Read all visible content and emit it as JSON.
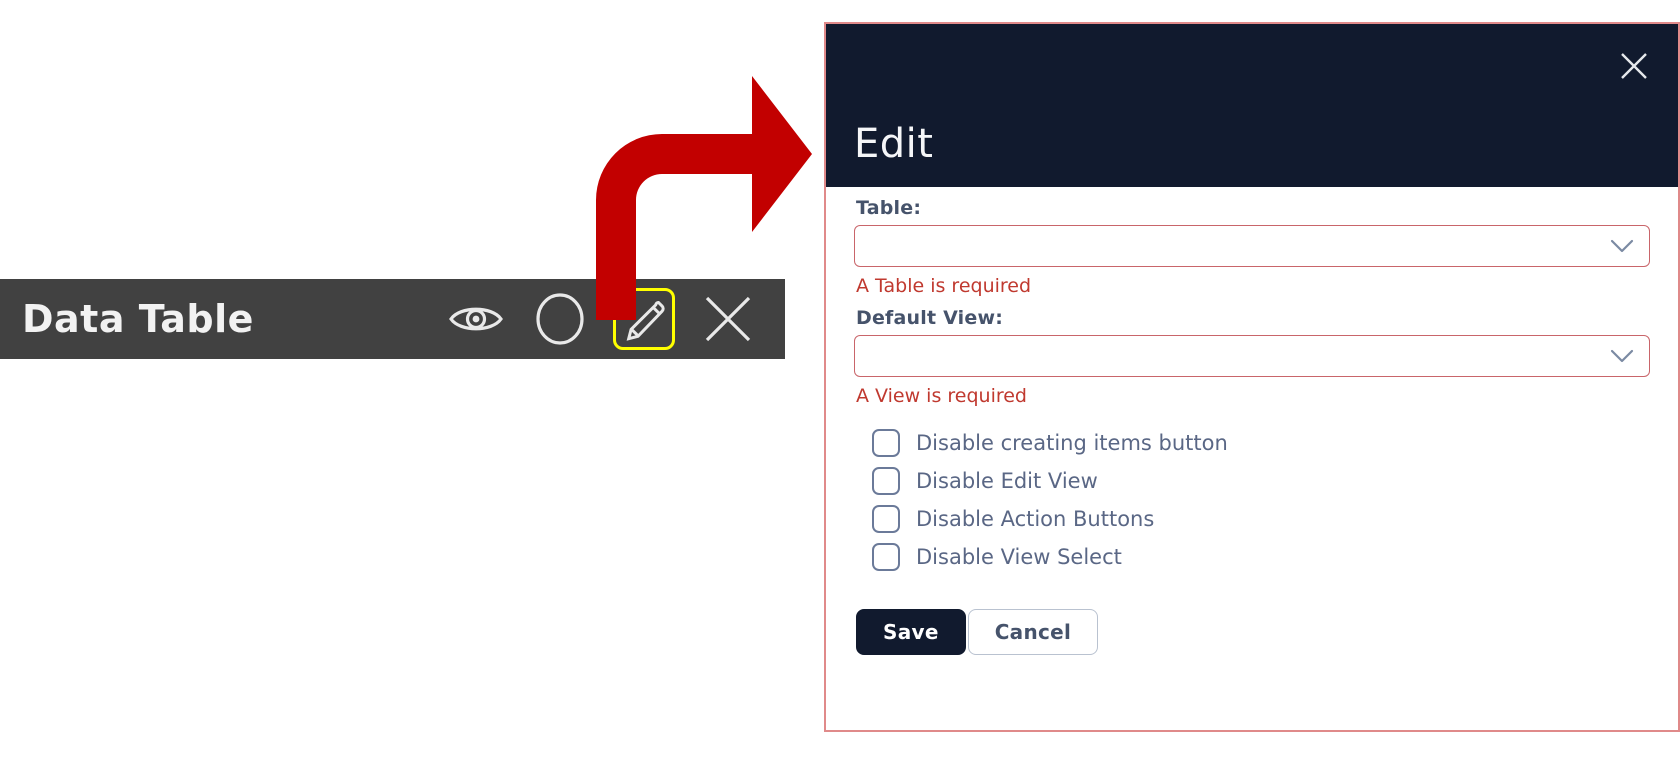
{
  "widget": {
    "title": "Data Table",
    "icons": [
      {
        "name": "preview-eye-icon",
        "label": "Preview",
        "highlighted": false
      },
      {
        "name": "circle-icon",
        "label": "Status",
        "highlighted": false
      },
      {
        "name": "edit-pencil-icon",
        "label": "Edit",
        "highlighted": true
      },
      {
        "name": "close-x-icon",
        "label": "Remove",
        "highlighted": false
      }
    ],
    "toolbar_bg": "#414141",
    "highlight_color": "#ffff00"
  },
  "annotation": {
    "arrow_name": "red-curved-arrow",
    "arrow_color": "#c20000"
  },
  "dialog": {
    "title": "Edit",
    "close_label": "×",
    "header_bg": "#111a2e",
    "border_color": "#e08a8a",
    "fields": [
      {
        "label": "Table:",
        "value": "",
        "error": "A Table is required",
        "name": "table-select"
      },
      {
        "label": "Default View:",
        "value": "",
        "error": "A View is required",
        "name": "default-view-select"
      }
    ],
    "checkboxes": [
      {
        "label": "Disable creating items button",
        "checked": false,
        "name": "checkbox-disable-creating-items-button"
      },
      {
        "label": "Disable Edit View",
        "checked": false,
        "name": "checkbox-disable-edit-view"
      },
      {
        "label": "Disable Action Buttons",
        "checked": false,
        "name": "checkbox-disable-action-buttons"
      },
      {
        "label": "Disable View Select",
        "checked": false,
        "name": "checkbox-disable-view-select"
      }
    ],
    "buttons": {
      "save": "Save",
      "cancel": "Cancel"
    },
    "error_color": "#c0392f",
    "label_color": "#46536b"
  }
}
